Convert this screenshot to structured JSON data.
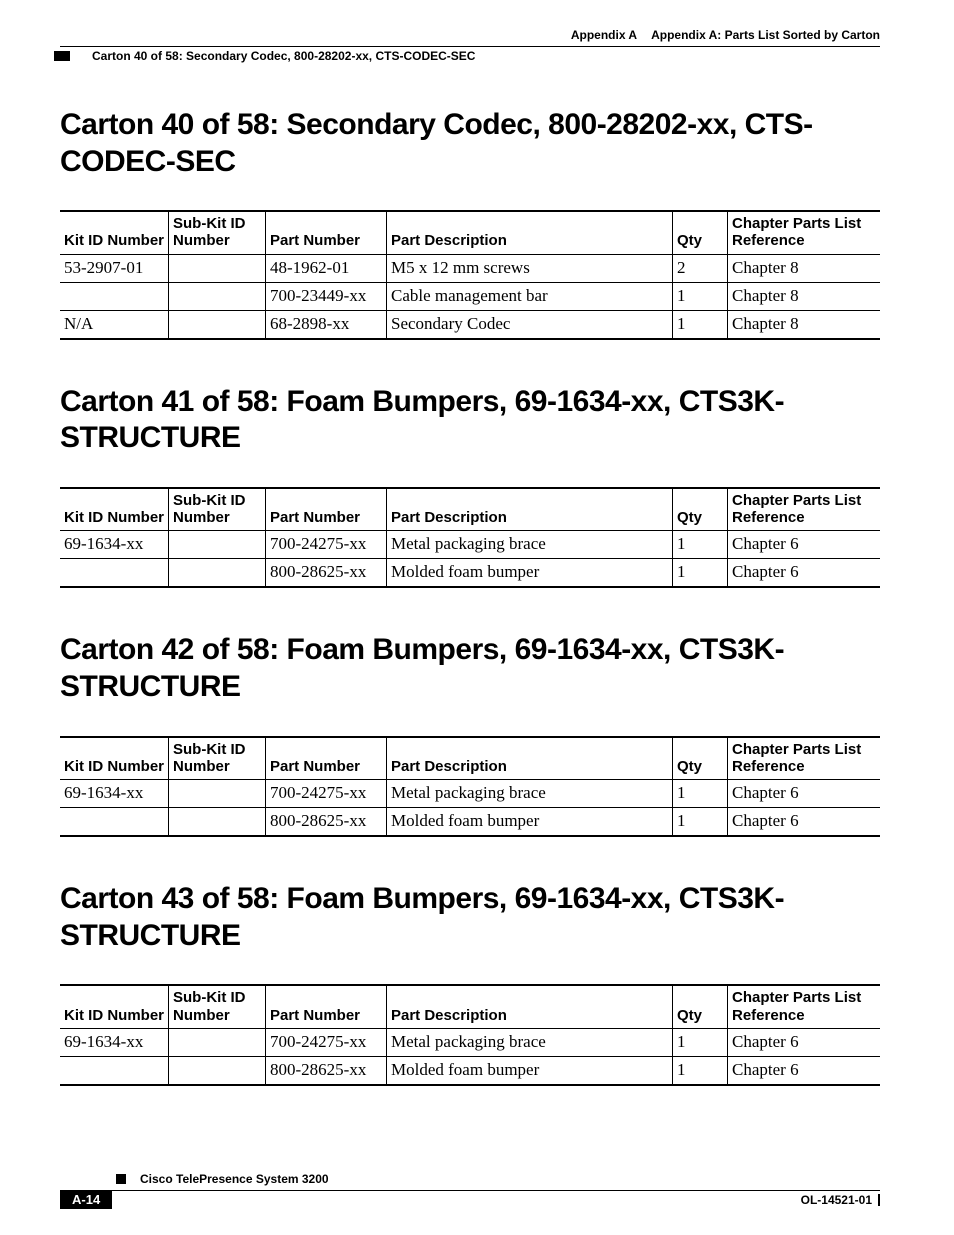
{
  "header": {
    "appendix_label": "Appendix A",
    "appendix_title": "Appendix A: Parts List Sorted by Carton",
    "breadcrumb": "Carton 40 of 58: Secondary Codec, 800-28202-xx, CTS-CODEC-SEC"
  },
  "columns": {
    "kit": "Kit ID Number",
    "sub": "Sub-Kit ID Number",
    "pn": "Part Number",
    "desc": "Part Description",
    "qty": "Qty",
    "ref": "Chapter Parts List Reference"
  },
  "sections": [
    {
      "heading": "Carton 40 of 58: Secondary Codec, 800-28202-xx, CTS-CODEC-SEC",
      "rows": [
        {
          "kit": "53-2907-01",
          "sub": "",
          "pn": "48-1962-01",
          "desc": "M5 x 12 mm screws",
          "qty": "2",
          "ref": "Chapter 8"
        },
        {
          "kit": "",
          "sub": "",
          "pn": "700-23449-xx",
          "desc": "Cable management bar",
          "qty": "1",
          "ref": "Chapter 8"
        },
        {
          "kit": "N/A",
          "sub": "",
          "pn": "68-2898-xx",
          "desc": "Secondary Codec",
          "qty": "1",
          "ref": "Chapter 8"
        }
      ]
    },
    {
      "heading": "Carton 41 of 58: Foam Bumpers, 69-1634-xx, CTS3K-STRUCTURE",
      "rows": [
        {
          "kit": "69-1634-xx",
          "sub": "",
          "pn": "700-24275-xx",
          "desc": "Metal packaging brace",
          "qty": "1",
          "ref": "Chapter 6"
        },
        {
          "kit": "",
          "sub": "",
          "pn": "800-28625-xx",
          "desc": "Molded foam bumper",
          "qty": "1",
          "ref": "Chapter 6"
        }
      ]
    },
    {
      "heading": "Carton 42 of 58: Foam Bumpers, 69-1634-xx, CTS3K-STRUCTURE",
      "rows": [
        {
          "kit": "69-1634-xx",
          "sub": "",
          "pn": "700-24275-xx",
          "desc": "Metal packaging brace",
          "qty": "1",
          "ref": "Chapter 6"
        },
        {
          "kit": "",
          "sub": "",
          "pn": "800-28625-xx",
          "desc": "Molded foam bumper",
          "qty": "1",
          "ref": "Chapter 6"
        }
      ]
    },
    {
      "heading": "Carton 43 of 58: Foam Bumpers, 69-1634-xx, CTS3K-STRUCTURE",
      "rows": [
        {
          "kit": "69-1634-xx",
          "sub": "",
          "pn": "700-24275-xx",
          "desc": "Metal packaging brace",
          "qty": "1",
          "ref": "Chapter 6"
        },
        {
          "kit": "",
          "sub": "",
          "pn": "800-28625-xx",
          "desc": "Molded foam bumper",
          "qty": "1",
          "ref": "Chapter 6"
        }
      ]
    }
  ],
  "footer": {
    "book_title": "Cisco TelePresence System 3200",
    "page_no": "A-14",
    "doc_id": "OL-14521-01"
  }
}
